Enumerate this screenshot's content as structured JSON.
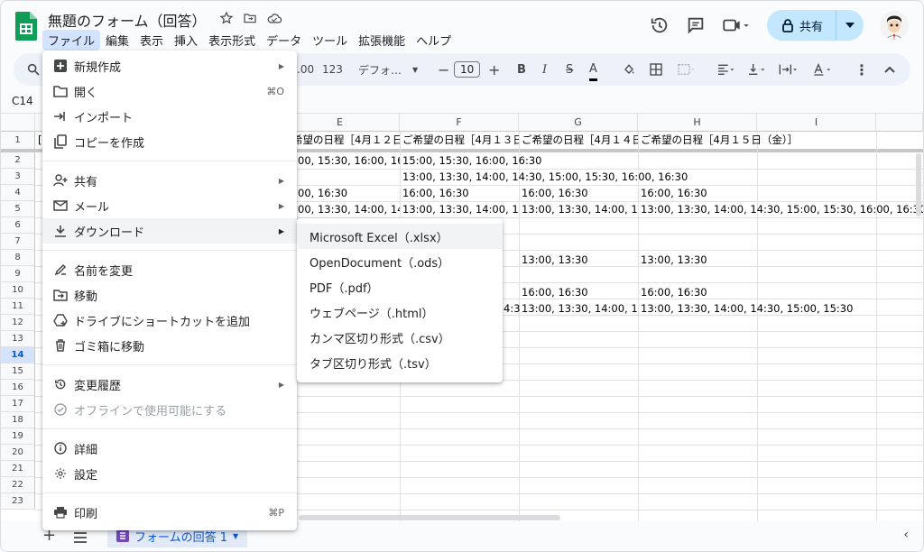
{
  "title": "無題のフォーム（回答）",
  "menubar": [
    "ファイル",
    "編集",
    "表示",
    "挿入",
    "表示形式",
    "データ",
    "ツール",
    "拡張機能",
    "ヘルプ"
  ],
  "share_label": "共有",
  "toolbar": {
    "decimal_label": ".00",
    "number_format": "123",
    "font": "デフォ…",
    "font_size": "10",
    "minus": "−",
    "plus": "+",
    "bold": "B",
    "italic": "I",
    "strike": "S",
    "text_color": "A"
  },
  "namebox": "C14",
  "columns": [
    "E",
    "F",
    "G",
    "H",
    "I"
  ],
  "rows": [
    "1",
    "2",
    "3",
    "4",
    "5",
    "6",
    "7",
    "8",
    "9",
    "10",
    "11",
    "12",
    "13",
    "14",
    "15",
    "16",
    "17",
    "18",
    "19",
    "20",
    "21",
    "22",
    "23"
  ],
  "selected_row": "14",
  "cells": {
    "r1_b": "[",
    "r1": [
      "希望の日程［4月１２日",
      "ご希望の日程［4月１３日",
      "ご希望の日程［4月１４日",
      "ご希望の日程［4月１５日（金）］"
    ],
    "r2_e": "00, 15:30, 16:00, 16:3",
    "r2_f": "15:00, 15:30, 16:00, 16:30",
    "r3_f": "13:00, 13:30, 14:00, 14:30, 15:00, 15:30, 16:00, 16:30",
    "r4_e": "00, 16:30",
    "r4_f": "16:00, 16:30",
    "r4_g": "16:00, 16:30",
    "r4_h": "16:00, 16:30",
    "r5_e": "00, 13:30, 14:00, 14:3",
    "r5_f": "13:00, 13:30, 14:00, 14:3",
    "r5_g": "13:00, 13:30, 14:00, 14:3",
    "r5_h": "13:00, 13:30, 14:00, 14:30, 15:00, 15:30, 16:00, 16:30",
    "r8_g": "13:00, 13:30",
    "r8_h": "13:00, 13:30",
    "r10_g": "16:00, 16:30",
    "r10_h": "16:00, 16:30",
    "r11_f": "4:3",
    "r11_g": "13:00, 13:30, 14:00, 14:3",
    "r11_h": "13:00, 13:30, 14:00, 14:30, 15:00, 15:30"
  },
  "file_menu": {
    "new": "新規作成",
    "open": "開く",
    "open_sc": "⌘O",
    "import": "インポート",
    "copy": "コピーを作成",
    "share": "共有",
    "email": "メール",
    "download": "ダウンロード",
    "rename": "名前を変更",
    "move": "移動",
    "shortcut": "ドライブにショートカットを追加",
    "trash": "ゴミ箱に移動",
    "history": "変更履歴",
    "offline": "オフラインで使用可能にする",
    "details": "詳細",
    "settings": "設定",
    "print": "印刷",
    "print_sc": "⌘P"
  },
  "download_menu": [
    "Microsoft Excel（.xlsx）",
    "OpenDocument（.ods）",
    "PDF（.pdf）",
    "ウェブページ（.html）",
    "カンマ区切り形式（.csv）",
    "タブ区切り形式（.tsv）"
  ],
  "sheet_tab": "フォームの回答 1",
  "colors": {
    "accent": "#0b57d0",
    "selection": "#d3e3fd",
    "share_bg": "#c2e7ff",
    "sheets_green": "#0f9d58"
  }
}
